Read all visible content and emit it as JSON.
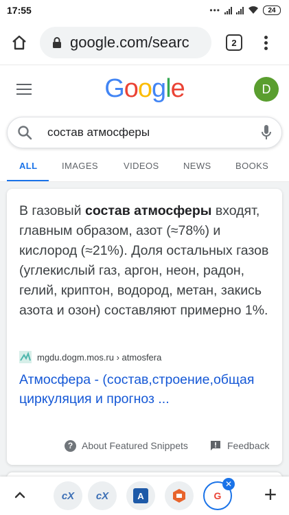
{
  "status_bar": {
    "time": "17:55",
    "battery": "24"
  },
  "browser": {
    "url": "google.com/searc",
    "tab_count": "2"
  },
  "google": {
    "logo_letters": [
      {
        "ch": "G",
        "color": "#4285F4"
      },
      {
        "ch": "o",
        "color": "#EA4335"
      },
      {
        "ch": "o",
        "color": "#FBBC05"
      },
      {
        "ch": "g",
        "color": "#4285F4"
      },
      {
        "ch": "l",
        "color": "#34A853"
      },
      {
        "ch": "e",
        "color": "#EA4335"
      }
    ],
    "avatar_letter": "D"
  },
  "search": {
    "query": "состав атмосферы"
  },
  "tabs": [
    "ALL",
    "IMAGES",
    "VIDEOS",
    "NEWS",
    "BOOKS"
  ],
  "snippet": {
    "text_before": "В газовый ",
    "text_bold": "состав атмосферы",
    "text_after": " входят, главным образом, азот (≈78%) и кислород (≈21%). Доля остальных газов (углекислый газ, аргон, неон, радон, гелий, криптон, водород, метан, закись азота и озон) составляют примерно 1%.",
    "source": "mgdu.dogm.mos.ru › atmosfera",
    "link_title": "Атмосфера - (состав,строение,общая циркуляция и прогноз ..."
  },
  "footer": {
    "about": "About Featured Snippets",
    "feedback": "Feedback"
  },
  "bottom_tabs": [
    {
      "icon": "translate-icon",
      "label": "cX"
    },
    {
      "icon": "translate-icon",
      "label": "cX"
    },
    {
      "icon": "translator-app-icon",
      "label": "A"
    },
    {
      "icon": "office-app-icon",
      "label": ""
    },
    {
      "icon": "google-g-icon",
      "label": "G"
    }
  ],
  "colors": {
    "accent": "#1a73e8",
    "link": "#1558d6"
  }
}
